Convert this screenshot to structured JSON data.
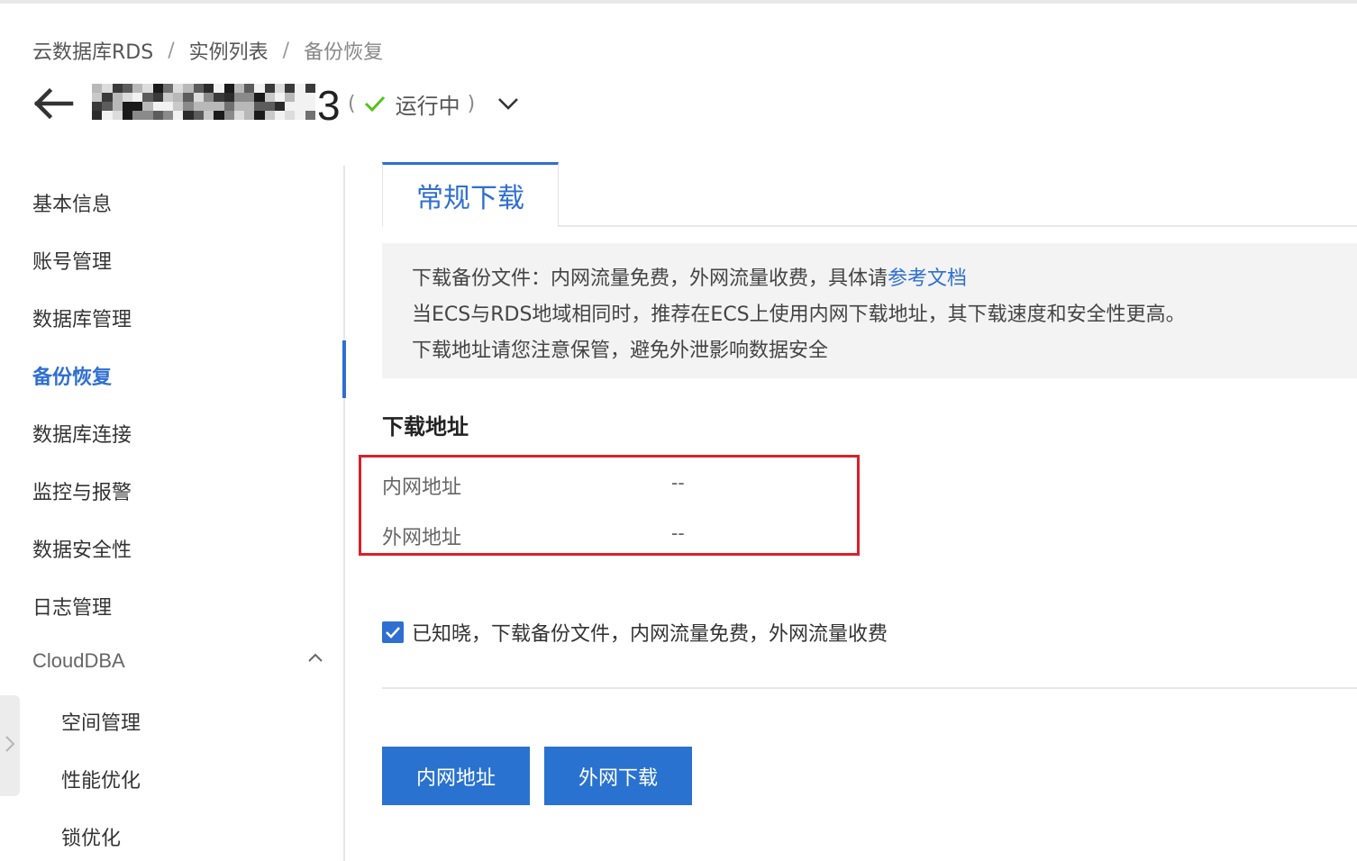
{
  "breadcrumb": {
    "item1": "云数据库RDS",
    "item2": "实例列表",
    "item3": "备份恢复",
    "separator": "/"
  },
  "header": {
    "instance_name_visible_tail": "3",
    "status_open": "(",
    "status_label": "运行中",
    "status_close": ")",
    "status_color": "#52c41a"
  },
  "sidebar": {
    "items": [
      {
        "label": "基本信息"
      },
      {
        "label": "账号管理"
      },
      {
        "label": "数据库管理"
      },
      {
        "label": "备份恢复",
        "active": true
      },
      {
        "label": "数据库连接"
      },
      {
        "label": "监控与报警"
      },
      {
        "label": "数据安全性"
      },
      {
        "label": "日志管理"
      }
    ],
    "group": {
      "label": "CloudDBA",
      "expanded": true,
      "children": [
        {
          "label": "空间管理"
        },
        {
          "label": "性能优化"
        },
        {
          "label": "锁优化"
        }
      ]
    }
  },
  "main": {
    "tab_label": "常规下载",
    "notice": {
      "line1_prefix": "下载备份文件：内网流量免费，外网流量收费，具体请",
      "line1_link": "参考文档",
      "line2": "当ECS与RDS地域相同时，推荐在ECS上使用内网下载地址，其下载速度和安全性更高。",
      "line3": "下载地址请您注意保管，避免外泄影响数据安全"
    },
    "section_title": "下载地址",
    "addresses": {
      "internal_label": "内网地址",
      "internal_value": "--",
      "external_label": "外网地址",
      "external_value": "--"
    },
    "acknowledge": {
      "checked": true,
      "text": "已知晓，下载备份文件，内网流量免费，外网流量收费"
    },
    "buttons": {
      "internal": "内网地址",
      "external": "外网下载"
    }
  },
  "colors": {
    "accent": "#2f6fd1",
    "button": "#2a72cf",
    "highlight_border": "#d9202a"
  }
}
